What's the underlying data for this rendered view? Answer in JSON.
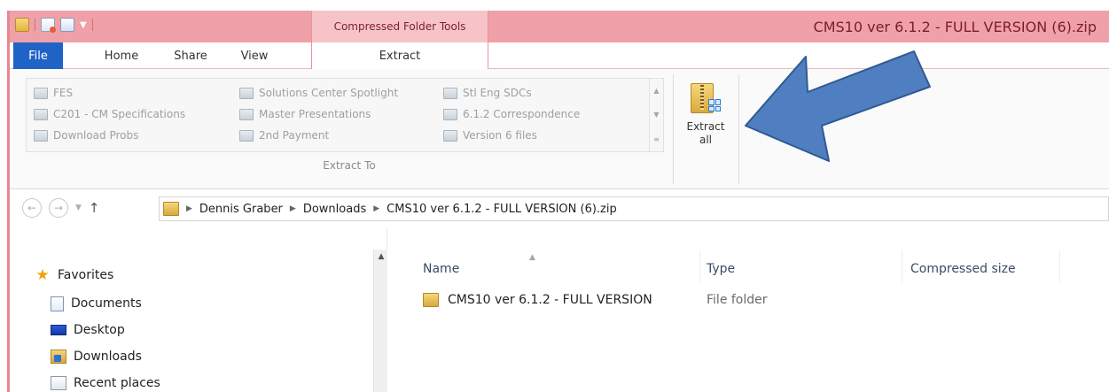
{
  "window": {
    "title": "CMS10 ver 6.1.2 - FULL VERSION (6).zip",
    "context_tab_group": "Compressed Folder Tools",
    "accent_color": "#f0a0a8"
  },
  "tabs": [
    {
      "label": "File"
    },
    {
      "label": "Home"
    },
    {
      "label": "Share"
    },
    {
      "label": "View"
    },
    {
      "label": "Extract"
    }
  ],
  "ribbon": {
    "extract_to": {
      "items": [
        {
          "label": "FES"
        },
        {
          "label": "C201 - CM Specifications"
        },
        {
          "label": "Download Probs"
        },
        {
          "label": "Solutions Center Spotlight"
        },
        {
          "label": "Master Presentations"
        },
        {
          "label": "2nd Payment"
        },
        {
          "label": "Stl Eng SDCs"
        },
        {
          "label": "6.1.2 Correspondence"
        },
        {
          "label": "Version 6 files"
        }
      ],
      "group_label": "Extract To"
    },
    "extract_all": {
      "line1": "Extract",
      "line2": "all"
    }
  },
  "address": {
    "crumbs": [
      {
        "label": "Dennis Graber"
      },
      {
        "label": "Downloads"
      },
      {
        "label": "CMS10 ver 6.1.2 - FULL VERSION (6).zip"
      }
    ]
  },
  "nav_pane": {
    "items": [
      {
        "label": "Favorites",
        "icon": "star-icon"
      },
      {
        "label": "Documents",
        "icon": "documents-icon"
      },
      {
        "label": "Desktop",
        "icon": "desktop-icon"
      },
      {
        "label": "Downloads",
        "icon": "downloads-icon"
      },
      {
        "label": "Recent places",
        "icon": "recent-places-icon"
      }
    ]
  },
  "file_list": {
    "columns": [
      {
        "label": "Name"
      },
      {
        "label": "Type"
      },
      {
        "label": "Compressed size"
      }
    ],
    "rows": [
      {
        "name": "CMS10 ver 6.1.2 - FULL VERSION",
        "type": "File folder"
      }
    ]
  },
  "annotation": {
    "color": "#4f7fc0"
  }
}
